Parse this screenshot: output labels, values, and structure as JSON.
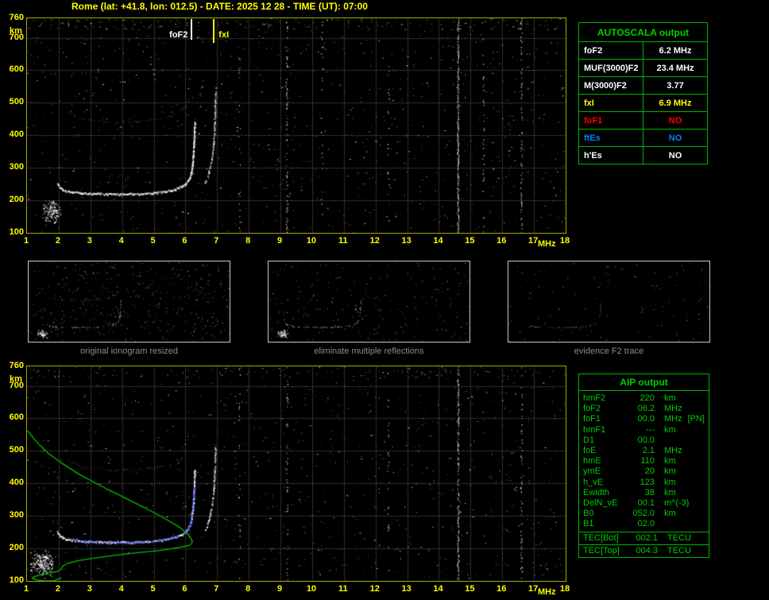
{
  "title": "Rome (lat: +41.8, lon: 012.5) - DATE: 2025 12 28 - TIME (UT): 07:00",
  "autoscala_table": {
    "title": "AUTOSCALA output",
    "rows": [
      {
        "label": "foF2",
        "value": "6.2 MHz",
        "color": "#ffffff"
      },
      {
        "label": "MUF(3000)F2",
        "value": "23.4 MHz",
        "color": "#ffffff"
      },
      {
        "label": "M(3000)F2",
        "value": "3.77",
        "color": "#ffffff"
      },
      {
        "label": "fxI",
        "value": "6.9 MHz",
        "color": "#ffff00"
      },
      {
        "label": "foF1",
        "value": "NO",
        "color": "#ff0000"
      },
      {
        "label": "ftEs",
        "value": "NO",
        "color": "#0080ff"
      },
      {
        "label": "h'Es",
        "value": "NO",
        "color": "#ffffff"
      }
    ]
  },
  "aip_table": {
    "title": "AIP output",
    "rows": [
      {
        "label": "hmF2",
        "value": "220",
        "unit": "km"
      },
      {
        "label": "foF2",
        "value": "06.2",
        "unit": "MHz"
      },
      {
        "label": "foF1",
        "value": "00.0",
        "unit": "MHz",
        "extra": "[PN]"
      },
      {
        "label": "hmF1",
        "value": "---",
        "unit": "km"
      },
      {
        "label": "D1",
        "value": "00.0",
        "unit": ""
      },
      {
        "label": "foE",
        "value": "2.1",
        "unit": "MHz"
      },
      {
        "label": "hmE",
        "value": "110",
        "unit": "km"
      },
      {
        "label": "ymE",
        "value": "20",
        "unit": "km"
      },
      {
        "label": "h_vE",
        "value": "123",
        "unit": "km"
      },
      {
        "label": "Ewidth",
        "value": "38",
        "unit": "km"
      },
      {
        "label": "DelN_vE",
        "value": "00.1",
        "unit": "m^(-3)"
      },
      {
        "label": "B0",
        "value": "052.0",
        "unit": "km"
      },
      {
        "label": "B1",
        "value": "02.0",
        "unit": ""
      }
    ],
    "tec_rows": [
      {
        "label": "TEC[Bot]",
        "value": "002.1",
        "unit": "TECU"
      },
      {
        "label": "TEC[Top]",
        "value": "004.3",
        "unit": "TECU"
      }
    ]
  },
  "thumbnails": [
    {
      "caption": "original ionogram resized",
      "features": {
        "seed": 41,
        "noise_dots": 420,
        "show_second_reflection": true,
        "show_cluster": true,
        "trace_alpha": 0.95
      }
    },
    {
      "caption": "eliminate multiple reflections",
      "features": {
        "seed": 42,
        "noise_dots": 230,
        "show_second_reflection": false,
        "show_cluster": true,
        "trace_alpha": 0.95
      }
    },
    {
      "caption": "evidence F2 trace",
      "features": {
        "seed": 43,
        "noise_dots": 110,
        "show_second_reflection": false,
        "show_cluster": false,
        "trace_alpha": 0.6
      }
    }
  ],
  "chart_data": [
    {
      "type": "scatter",
      "title": "Ionogram with AUTOSCALA trace identification, Rome 2025-12-28 07:00 UT",
      "xlabel": "MHz",
      "ylabel": "km",
      "xlim": [
        1,
        18
      ],
      "ylim": [
        100,
        760
      ],
      "x_ticks": [
        1,
        2,
        3,
        4,
        5,
        6,
        7,
        8,
        9,
        10,
        11,
        12,
        13,
        14,
        15,
        16,
        17,
        18
      ],
      "y_ticks": [
        760,
        700,
        600,
        500,
        400,
        300,
        200,
        100
      ],
      "grid": true,
      "legend": "none",
      "markers": [
        {
          "label": "foF2",
          "f_mhz": 6.2,
          "color": "#ffffff",
          "label_side": "left"
        },
        {
          "label": "fxI",
          "f_mhz": 6.9,
          "color": "#ffff00",
          "label_side": "right"
        }
      ],
      "interference_bands": [
        [
          7.7,
          0.1
        ],
        [
          9.2,
          0.25
        ],
        [
          10.3,
          0.08
        ],
        [
          12.4,
          0.1
        ],
        [
          14.6,
          0.75
        ],
        [
          15.4,
          0.12
        ],
        [
          16.6,
          0.22
        ]
      ],
      "series": [
        {
          "name": "F2 layer o-mode trace",
          "role": "trace",
          "color": "#ffffff",
          "points": [
            [
              1.95,
              252
            ],
            [
              2.05,
              238
            ],
            [
              2.2,
              230
            ],
            [
              2.5,
              226
            ],
            [
              2.9,
              223
            ],
            [
              3.3,
              221
            ],
            [
              3.7,
              220
            ],
            [
              4.1,
              220
            ],
            [
              4.5,
              221
            ],
            [
              4.9,
              223
            ],
            [
              5.2,
              226
            ],
            [
              5.5,
              231
            ],
            [
              5.75,
              238
            ],
            [
              5.95,
              248
            ],
            [
              6.08,
              262
            ],
            [
              6.16,
              282
            ],
            [
              6.21,
              310
            ],
            [
              6.24,
              345
            ],
            [
              6.26,
              385
            ],
            [
              6.27,
              420
            ],
            [
              6.28,
              445
            ]
          ]
        },
        {
          "name": "F2 layer x-mode trace",
          "role": "xmode",
          "color": "#ffffff",
          "points": [
            [
              6.6,
              255
            ],
            [
              6.7,
              280
            ],
            [
              6.78,
              310
            ],
            [
              6.84,
              345
            ],
            [
              6.88,
              385
            ],
            [
              6.9,
              425
            ],
            [
              6.92,
              470
            ],
            [
              6.93,
              515
            ],
            [
              6.94,
              555
            ]
          ]
        },
        {
          "name": "second hop reflection",
          "role": "second",
          "color": "#bbbbbb",
          "points": [
            [
              2.3,
              470
            ],
            [
              2.7,
              453
            ],
            [
              3.2,
              445
            ],
            [
              3.8,
              441
            ],
            [
              4.4,
              442
            ],
            [
              5.0,
              448
            ],
            [
              5.5,
              458
            ],
            [
              5.8,
              471
            ],
            [
              6.0,
              489
            ],
            [
              6.12,
              516
            ]
          ]
        },
        {
          "name": "E-region echoes",
          "role": "cluster",
          "color": "#ffffff",
          "region": {
            "f0": 1.45,
            "f1": 2.1,
            "h0": 128,
            "h1": 208,
            "n": 130
          }
        }
      ]
    },
    {
      "type": "scatter",
      "title": "Ionogram with AIP electron density profile inversion",
      "xlabel": "MHz",
      "ylabel": "km",
      "xlim": [
        1,
        18
      ],
      "ylim": [
        100,
        760
      ],
      "x_ticks": [
        1,
        2,
        3,
        4,
        5,
        6,
        7,
        8,
        9,
        10,
        11,
        12,
        13,
        14,
        15,
        16,
        17,
        18
      ],
      "y_ticks": [
        760,
        700,
        600,
        500,
        400,
        300,
        200,
        100
      ],
      "grid": true,
      "legend": "none",
      "markers": [],
      "interference_bands": [
        [
          7.7,
          0.08
        ],
        [
          9.2,
          0.18
        ],
        [
          12.4,
          0.08
        ],
        [
          14.6,
          0.6
        ],
        [
          16.6,
          0.16
        ]
      ],
      "series": [
        {
          "name": "F2 layer o-mode trace",
          "role": "trace",
          "color": "#ffffff",
          "points": [
            [
              1.95,
              252
            ],
            [
              2.05,
              238
            ],
            [
              2.2,
              230
            ],
            [
              2.5,
              226
            ],
            [
              2.9,
              223
            ],
            [
              3.3,
              221
            ],
            [
              3.7,
              220
            ],
            [
              4.1,
              220
            ],
            [
              4.5,
              221
            ],
            [
              4.9,
              223
            ],
            [
              5.2,
              226
            ],
            [
              5.5,
              231
            ],
            [
              5.75,
              238
            ],
            [
              5.95,
              248
            ],
            [
              6.08,
              262
            ],
            [
              6.16,
              282
            ],
            [
              6.21,
              310
            ],
            [
              6.24,
              345
            ],
            [
              6.26,
              385
            ],
            [
              6.27,
              420
            ],
            [
              6.28,
              445
            ]
          ]
        },
        {
          "name": "F2 layer x-mode trace",
          "role": "xmode",
          "color": "#ffffff",
          "points": [
            [
              6.6,
              255
            ],
            [
              6.7,
              280
            ],
            [
              6.78,
              310
            ],
            [
              6.84,
              345
            ],
            [
              6.88,
              385
            ],
            [
              6.9,
              425
            ],
            [
              6.92,
              470
            ],
            [
              6.93,
              515
            ]
          ]
        },
        {
          "name": "second hop reflection",
          "role": "second",
          "color": "#aaaaaa",
          "points": [
            [
              2.3,
              470
            ],
            [
              2.7,
              453
            ],
            [
              3.2,
              445
            ],
            [
              3.8,
              441
            ],
            [
              4.4,
              442
            ],
            [
              5.0,
              448
            ],
            [
              5.5,
              458
            ],
            [
              5.8,
              471
            ],
            [
              6.0,
              489
            ]
          ]
        },
        {
          "name": "E-region echoes",
          "role": "cluster",
          "color": "#ffffff",
          "region": {
            "f0": 1.03,
            "f1": 2.0,
            "h0": 106,
            "h1": 200,
            "n": 210
          }
        },
        {
          "name": "AIP electron density profile",
          "role": "profile",
          "color": "#00c000",
          "points": [
            [
              1.02,
              562
            ],
            [
              1.3,
              528
            ],
            [
              1.65,
              494
            ],
            [
              2.1,
              462
            ],
            [
              2.65,
              428
            ],
            [
              3.3,
              394
            ],
            [
              4.0,
              360
            ],
            [
              4.7,
              326
            ],
            [
              5.3,
              295
            ],
            [
              5.8,
              266
            ],
            [
              6.05,
              246
            ],
            [
              6.18,
              230
            ],
            [
              6.22,
              220
            ],
            [
              6.15,
              210
            ],
            [
              5.8,
              203
            ],
            [
              5.2,
              194
            ],
            [
              4.5,
              187
            ],
            [
              3.8,
              179
            ],
            [
              3.1,
              170
            ],
            [
              2.6,
              162
            ],
            [
              2.25,
              153
            ],
            [
              2.12,
              144
            ],
            [
              2.08,
              136
            ],
            [
              1.95,
              129
            ],
            [
              1.7,
              125
            ],
            [
              1.45,
              120
            ],
            [
              1.25,
              114
            ],
            [
              1.17,
              108
            ],
            [
              1.3,
              103
            ],
            [
              1.55,
              100
            ],
            [
              1.85,
              101
            ],
            [
              2.0,
              105
            ],
            [
              2.08,
              110
            ]
          ]
        },
        {
          "name": "fitted F2 trace",
          "role": "fitted",
          "color": "#3344ff",
          "points": [
            [
              2.35,
              229
            ],
            [
              2.7,
              225
            ],
            [
              3.1,
              222
            ],
            [
              3.5,
              220
            ],
            [
              3.9,
              219
            ],
            [
              4.3,
              220
            ],
            [
              4.7,
              222
            ],
            [
              5.05,
              225
            ],
            [
              5.35,
              229
            ],
            [
              5.6,
              234
            ],
            [
              5.8,
              241
            ],
            [
              5.95,
              250
            ],
            [
              6.07,
              263
            ],
            [
              6.15,
              280
            ],
            [
              6.2,
              302
            ],
            [
              6.23,
              332
            ],
            [
              6.25,
              365
            ],
            [
              6.26,
              398
            ]
          ]
        }
      ]
    }
  ]
}
